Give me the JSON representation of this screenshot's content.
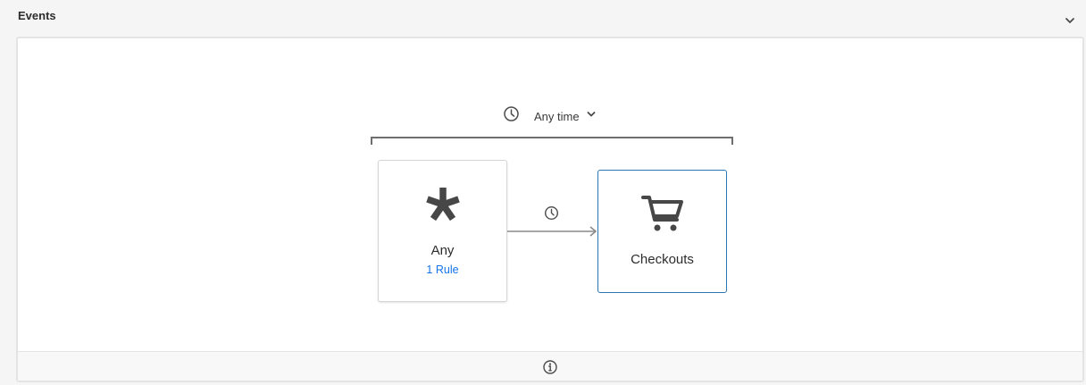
{
  "section": {
    "title": "Events",
    "collapse_icon": "chevron-down-icon"
  },
  "sequence": {
    "time_constraint": {
      "icon": "clock-icon",
      "label": "Any time",
      "dropdown_icon": "chevron-down-icon"
    },
    "nodes": [
      {
        "icon": "asterisk-icon",
        "label": "Any",
        "rule_link": "1 Rule",
        "selected": false
      },
      {
        "icon": "shopping-cart-icon",
        "label": "Checkouts",
        "selected": true
      }
    ],
    "connector": {
      "icon": "clock-icon"
    }
  },
  "footer": {
    "icon": "info-icon"
  },
  "colors": {
    "accent": "#2a76b2",
    "link": "#1473e6",
    "icon": "#4b4b4b",
    "background": "#f5f5f5"
  }
}
